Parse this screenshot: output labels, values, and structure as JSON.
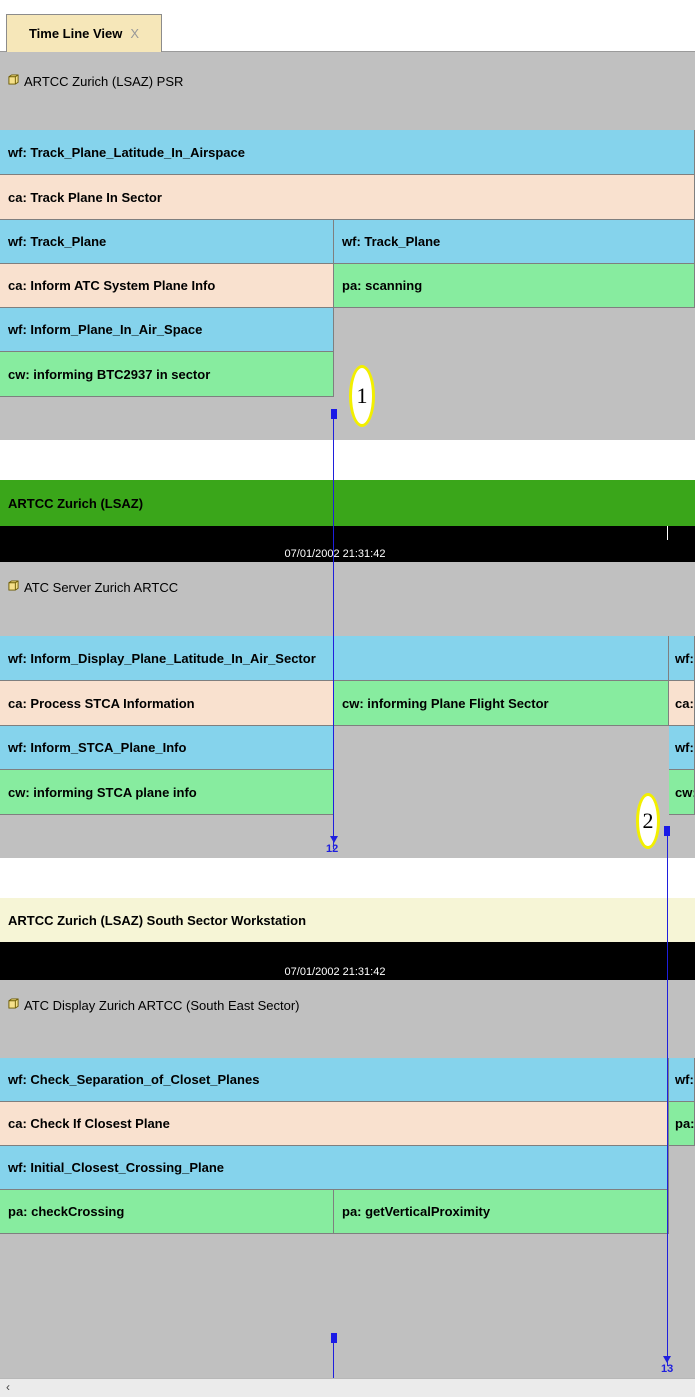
{
  "tab": {
    "label": "Time Line View",
    "close": "X"
  },
  "section1": {
    "component": "ARTCC Zurich (LSAZ) PSR",
    "rows": {
      "r1": "wf: Track_Plane_Latitude_In_Airspace",
      "r2": "ca: Track Plane In Sector",
      "r3a": "wf: Track_Plane",
      "r3b": "wf: Track_Plane",
      "r4a": "ca: Inform ATC System Plane Info",
      "r4b": "pa: scanning",
      "r5": "wf: Inform_Plane_In_Air_Space",
      "r6": "cw: informing BTC2937 in sector"
    }
  },
  "section2": {
    "header": "ARTCC Zurich (LSAZ)",
    "timestamp": "07/01/2002 21:31:42",
    "component": "ATC Server Zurich ARTCC",
    "rows": {
      "r1": "wf: Inform_Display_Plane_Latitude_In_Air_Sector",
      "r1c": "wf:",
      "r2a": "ca: Process STCA Information",
      "r2b": "cw: informing Plane Flight Sector",
      "r2c": "ca:",
      "r3": "wf: Inform_STCA_Plane_Info",
      "r3c": "wf:",
      "r4": "cw: informing STCA plane info",
      "r4c": "cw:"
    }
  },
  "section3": {
    "header": "ARTCC Zurich (LSAZ) South Sector Workstation",
    "timestamp": "07/01/2002 21:31:42",
    "component": "ATC Display Zurich ARTCC (South East Sector)",
    "rows": {
      "r1": "wf: Check_Separation_of_Closet_Planes",
      "r1c": "wf:",
      "r2": "ca: Check If Closest Plane",
      "r2c": "pa:",
      "r3": "wf: Initial_Closest_Crossing_Plane",
      "r4a": "pa: checkCrossing",
      "r4b": "pa: getVerticalProximity"
    }
  },
  "markers": {
    "m1_label": "12",
    "m2_label": "13"
  },
  "callouts": {
    "c1": "1",
    "c2": "2"
  },
  "scrollbar": {
    "left_arrow": "‹"
  },
  "colors": {
    "workflow": "#85d3ec",
    "activity": "#f9e1cf",
    "process": "#87ec9f",
    "header_green": "#3aa61a",
    "header_yellow": "#f6f5d6",
    "marker": "#1f1fdd",
    "callout": "#f2ef00"
  }
}
